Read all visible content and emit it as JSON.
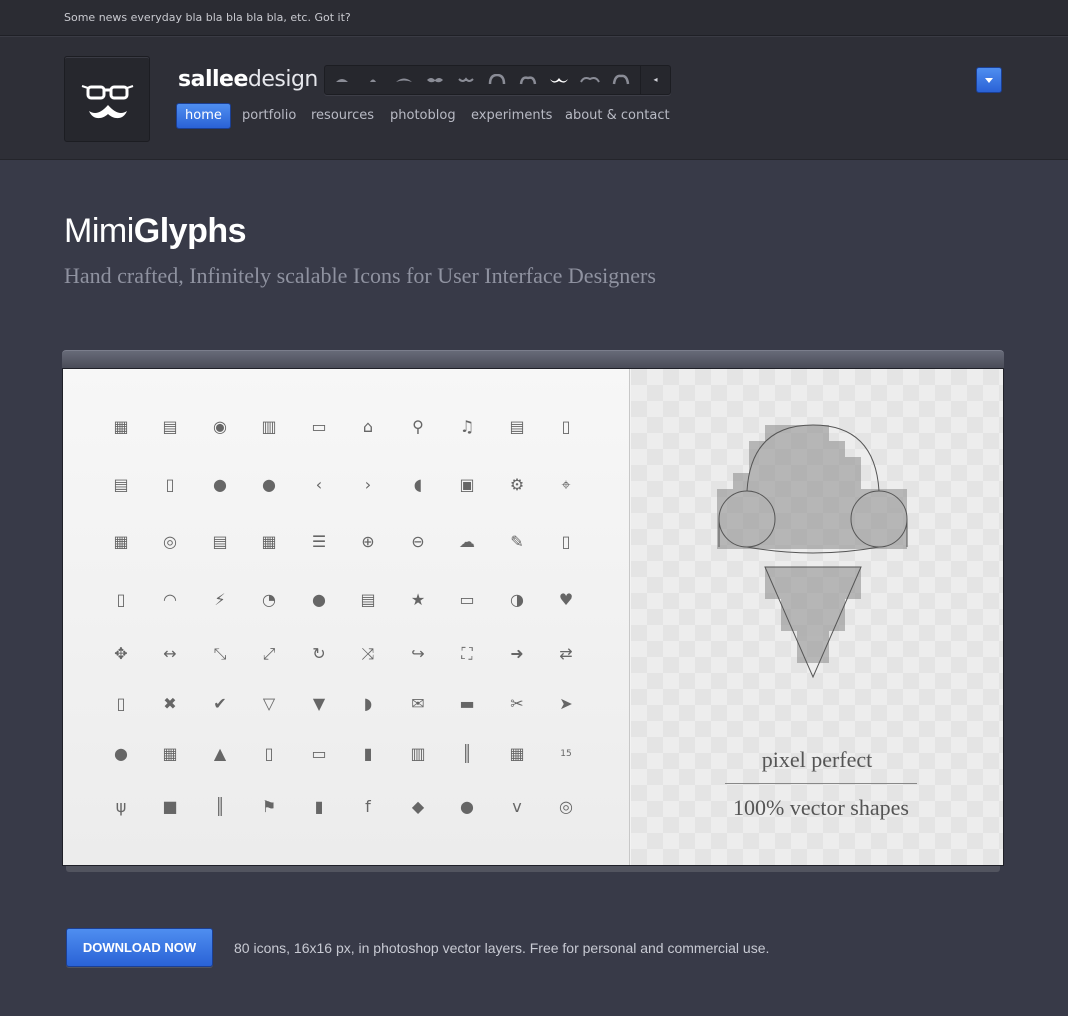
{
  "news": {
    "text": "Some news everyday bla bla bla bla bla, etc. Got it?"
  },
  "brand": {
    "bold": "sallee",
    "light": "design"
  },
  "stache_selector": {
    "items": [
      "mustache-1",
      "mustache-2",
      "mustache-3",
      "mustache-4",
      "mustache-5",
      "mustache-6",
      "mustache-7",
      "mustache-8",
      "mustache-9",
      "mustache-10"
    ],
    "arrow": "◂"
  },
  "nav": {
    "items": [
      {
        "label": "home",
        "active": true
      },
      {
        "label": "portfolio"
      },
      {
        "label": "resources"
      },
      {
        "label": "photoblog"
      },
      {
        "label": "experiments"
      },
      {
        "label": "about & contact"
      }
    ]
  },
  "hero": {
    "title_light": "Mimi",
    "title_bold": "Glyphs",
    "subtitle": "Hand crafted, Infinitely scalable Icons for User Interface Designers"
  },
  "preview": {
    "caption1": "pixel perfect",
    "caption2": "100% vector shapes"
  },
  "footer": {
    "download_label": "DOWNLOAD NOW",
    "description": "80 icons, 16x16 px, in photoshop vector layers. Free for personal and commercial use."
  },
  "glyphs": [
    [
      "calculator-icon",
      "▦"
    ],
    [
      "keyboard-icon",
      "▤"
    ],
    [
      "camera-icon",
      "◉"
    ],
    [
      "printer-icon",
      "▥"
    ],
    [
      "inbox-icon",
      "▭"
    ],
    [
      "home-icon",
      "⌂"
    ],
    [
      "search-icon",
      "⚲"
    ],
    [
      "music-icon",
      "♫"
    ],
    [
      "documents-icon",
      "▤"
    ],
    [
      "document-icon",
      "▯"
    ],
    [
      "copy-icon",
      "▤"
    ],
    [
      "file-icon",
      "▯"
    ],
    [
      "user-icon",
      "●"
    ],
    [
      "users-icon",
      "●"
    ],
    [
      "chevron-left-icon",
      "‹"
    ],
    [
      "chevron-right-icon",
      "›"
    ],
    [
      "mouse-icon",
      "◖"
    ],
    [
      "image-icon",
      "▣"
    ],
    [
      "gear-icon",
      "⚙"
    ],
    [
      "map-pin-icon",
      "⌖"
    ],
    [
      "calendar-icon",
      "▦"
    ],
    [
      "safe-icon",
      "◎"
    ],
    [
      "newspaper-icon",
      "▤"
    ],
    [
      "grid-icon",
      "▦"
    ],
    [
      "list-icon",
      "☰"
    ],
    [
      "plus-circle-icon",
      "⊕"
    ],
    [
      "minus-circle-icon",
      "⊖"
    ],
    [
      "cloud-icon",
      "☁"
    ],
    [
      "pencil-icon",
      "✎"
    ],
    [
      "phone-icon",
      "▯"
    ],
    [
      "ipod-icon",
      "▯"
    ],
    [
      "headphones-icon",
      "◠"
    ],
    [
      "lightning-icon",
      "⚡"
    ],
    [
      "pie-chart-icon",
      "◔"
    ],
    [
      "speech-bubble-icon",
      "●"
    ],
    [
      "chat-icon",
      "▤"
    ],
    [
      "star-icon",
      "★"
    ],
    [
      "monitor-icon",
      "▭"
    ],
    [
      "contrast-icon",
      "◑"
    ],
    [
      "heart-icon",
      "♥"
    ],
    [
      "move-icon",
      "✥"
    ],
    [
      "resize-horizontal-icon",
      "↔"
    ],
    [
      "expand-icon",
      "⤡"
    ],
    [
      "collapse-icon",
      "⤢"
    ],
    [
      "refresh-icon",
      "↻"
    ],
    [
      "shuffle-icon",
      "⤨"
    ],
    [
      "share-icon",
      "↪"
    ],
    [
      "fullscreen-icon",
      "⛶"
    ],
    [
      "arrow-right-icon",
      "➜"
    ],
    [
      "repeat-icon",
      "⇄"
    ],
    [
      "trash-icon",
      "▯"
    ],
    [
      "close-icon",
      "✖"
    ],
    [
      "check-icon",
      "✔"
    ],
    [
      "glass-icon",
      "▽"
    ],
    [
      "ice-cream-icon",
      "▼"
    ],
    [
      "gamepad-icon",
      "◗"
    ],
    [
      "mail-icon",
      "✉"
    ],
    [
      "car-icon",
      "▬"
    ],
    [
      "scissors-icon",
      "✂"
    ],
    [
      "cursor-icon",
      "➤"
    ],
    [
      "bulb-icon",
      "●"
    ],
    [
      "calculator-2-icon",
      "▦"
    ],
    [
      "sailboat-icon",
      "▲"
    ],
    [
      "mug-icon",
      "▯"
    ],
    [
      "credit-card-icon",
      "▭"
    ],
    [
      "lighter-icon",
      "▮"
    ],
    [
      "columns-icon",
      "▥"
    ],
    [
      "barcode-icon",
      "║"
    ],
    [
      "apps-icon",
      "▦"
    ],
    [
      "date-icon",
      "15"
    ],
    [
      "fork-knife-icon",
      "ψ"
    ],
    [
      "video-icon",
      "■"
    ],
    [
      "equalizer-icon",
      "║"
    ],
    [
      "flag-icon",
      "⚑"
    ],
    [
      "microphone-icon",
      "▮"
    ],
    [
      "facebook-icon",
      "f"
    ],
    [
      "twitter-icon",
      "◆"
    ],
    [
      "flickr-icon",
      "●"
    ],
    [
      "vimeo-icon",
      "v"
    ],
    [
      "dribbble-icon",
      "◎"
    ]
  ]
}
